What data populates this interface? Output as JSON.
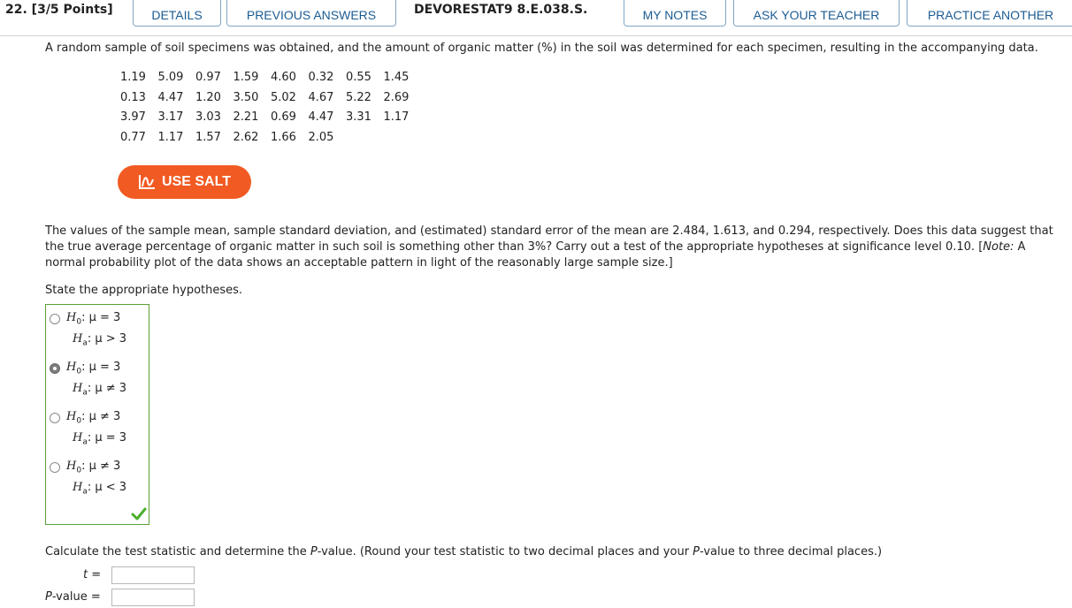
{
  "header": {
    "question_number": "22. [3/5 Points]",
    "tabs": [
      "DETAILS",
      "PREVIOUS ANSWERS",
      "MY NOTES",
      "ASK YOUR TEACHER",
      "PRACTICE ANOTHER"
    ],
    "problem_code": "DEVORESTAT9 8.E.038.S."
  },
  "intro": "A random sample of soil specimens was obtained, and the amount of organic matter (%) in the soil was determined for each specimen, resulting in the accompanying data.",
  "data_rows": [
    [
      "1.19",
      "5.09",
      "0.97",
      "1.59",
      "4.60",
      "0.32",
      "0.55",
      "1.45"
    ],
    [
      "0.13",
      "4.47",
      "1.20",
      "3.50",
      "5.02",
      "4.67",
      "5.22",
      "2.69"
    ],
    [
      "3.97",
      "3.17",
      "3.03",
      "2.21",
      "0.69",
      "4.47",
      "3.31",
      "1.17"
    ],
    [
      "0.77",
      "1.17",
      "1.57",
      "2.62",
      "1.66",
      "2.05"
    ]
  ],
  "salt_button": "USE SALT",
  "paragraph_lines": [
    "The values of the sample mean, sample standard deviation, and (estimated) standard error of the mean are 2.484, 1.613, and 0.294, respectively. Does this data suggest that",
    "the true average percentage of organic matter in such soil is something other than 3%? Carry out a test of the appropriate hypotheses at significance level 0.10. [",
    "normal probability plot of the data shows an acceptable pattern in light of the reasonably large sample size.]"
  ],
  "note_word": "Note:",
  "note_tail": " A",
  "state_prompt": "State the appropriate hypotheses.",
  "choices": [
    {
      "h0": ": μ = 3",
      "ha": ": μ > 3",
      "selected": false
    },
    {
      "h0": ": μ = 3",
      "ha": ": μ ≠ 3",
      "selected": true
    },
    {
      "h0": ": μ ≠ 3",
      "ha": ": μ = 3",
      "selected": false
    },
    {
      "h0": ": μ ≠ 3",
      "ha": ": μ < 3",
      "selected": false
    }
  ],
  "h_symbol": "H",
  "h0_sub": "0",
  "ha_sub": "a",
  "calc_prompt_parts": [
    "Calculate the test statistic and determine the ",
    "P",
    "-value. (Round your test statistic to two decimal places and your ",
    "P",
    "-value to three decimal places.)"
  ],
  "t_label": "t  =",
  "p_label_italic": "P",
  "p_label_rest": "-value  =",
  "t_value": "",
  "p_value": "",
  "colors": {
    "tab_text": "#1c5c93",
    "salt": "#f15a22",
    "correct_border": "#5aa036",
    "check": "#4caf2d"
  }
}
